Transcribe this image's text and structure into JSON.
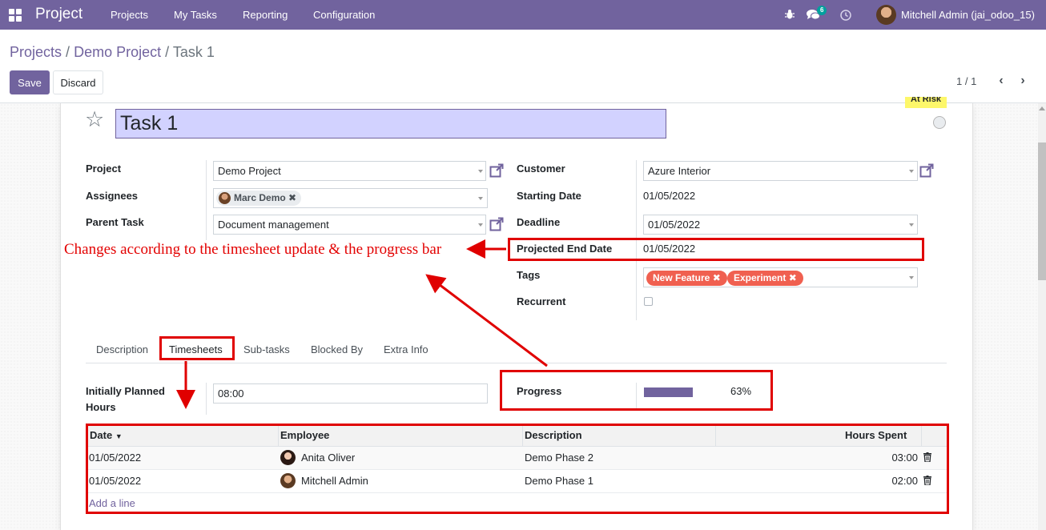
{
  "navbar": {
    "brand": "Project",
    "menu": [
      "Projects",
      "My Tasks",
      "Reporting",
      "Configuration"
    ],
    "messages_count": "6",
    "user": "Mitchell Admin (jai_odoo_15)",
    "icons": [
      "apps-grid-icon",
      "bug-icon",
      "chat-icon",
      "clock-icon"
    ]
  },
  "breadcrumb": {
    "items": [
      "Projects",
      "Demo Project"
    ],
    "separator": "/",
    "current": "Task 1"
  },
  "buttons": {
    "save": "Save",
    "discard": "Discard"
  },
  "pager": {
    "value": "1 / 1"
  },
  "task": {
    "title": "Task 1",
    "status_label": "At Risk"
  },
  "fields": {
    "project_label": "Project",
    "project_value": "Demo Project",
    "assignees_label": "Assignees",
    "assignee_tag": "Marc Demo",
    "parent_label": "Parent Task",
    "parent_value": "Document management",
    "customer_label": "Customer",
    "customer_value": "Azure Interior",
    "start_label": "Starting Date",
    "start_value": "01/05/2022",
    "deadline_label": "Deadline",
    "deadline_value": "01/05/2022",
    "projected_label": "Projected End Date",
    "projected_value": "01/05/2022",
    "tags_label": "Tags",
    "tags": [
      "New Feature",
      "Experiment"
    ],
    "recurrent_label": "Recurrent",
    "recurrent_checked": false
  },
  "annotation": {
    "text": "Changes according to the timesheet update & the progress bar",
    "color": "#e00000"
  },
  "tabs": [
    "Description",
    "Timesheets",
    "Sub-tasks",
    "Blocked By",
    "Extra Info"
  ],
  "active_tab": "Timesheets",
  "timesheet": {
    "planned_label_1": "Initially Planned",
    "planned_label_2": "Hours",
    "planned_value": "08:00",
    "progress_label": "Progress",
    "progress_text": "63%",
    "progress_percent": 63,
    "columns": [
      "Date",
      "Employee",
      "Description",
      "Hours Spent"
    ],
    "rows": [
      {
        "date": "01/05/2022",
        "employee": "Anita Oliver",
        "description": "Demo Phase 2",
        "hours": "03:00"
      },
      {
        "date": "01/05/2022",
        "employee": "Mitchell Admin",
        "description": "Demo Phase 1",
        "hours": "02:00"
      }
    ],
    "add_line": "Add a line"
  },
  "colors": {
    "brand": "#71639e",
    "title_highlight": "#d2d2ff",
    "tag_red": "#f06050",
    "annotation": "#e00000"
  }
}
